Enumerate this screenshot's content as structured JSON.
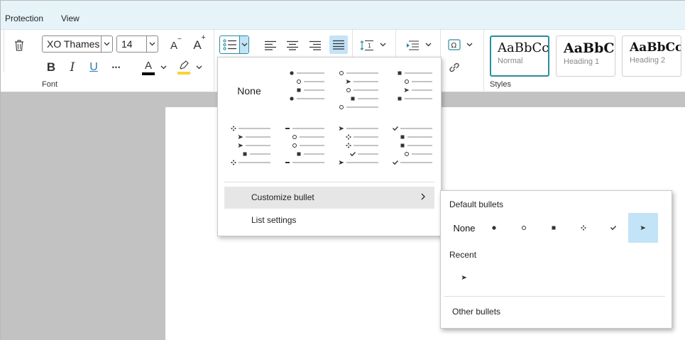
{
  "menubar": {
    "items": [
      "Protection",
      "View"
    ]
  },
  "font": {
    "name": "XO Thames",
    "size": "14",
    "group_label": "Font",
    "bold_icon": "B",
    "italic_icon": "I",
    "underline_icon": "U",
    "more_icon": "•••",
    "font_color_icon": "A",
    "font_color": "#000000",
    "highlight_color": "#f7d33c",
    "grow_icon": "A",
    "shrink_icon": "A"
  },
  "styles": {
    "group_label": "Styles",
    "items": [
      {
        "preview": "AaBbCc",
        "name": "Normal"
      },
      {
        "preview": "AaBbC",
        "name": "Heading 1"
      },
      {
        "preview": "AaBbCc",
        "name": "Heading 2"
      }
    ]
  },
  "bullets_dropdown": {
    "none_label": "None",
    "library": [
      [
        "filled-circle",
        "open-circle",
        "square",
        "filled-circle"
      ],
      [
        "open-circle",
        "arrow",
        "open-circle",
        "square",
        "open-circle"
      ],
      [
        "square",
        "open-circle",
        "arrow",
        "square"
      ],
      [
        "diamond4",
        "arrow",
        "arrow",
        "square",
        "diamond4"
      ],
      [
        "dash",
        "open-circle",
        "open-circle",
        "square",
        "dash"
      ],
      [
        "arrow",
        "diamond4",
        "diamond4",
        "check",
        "arrow"
      ],
      [
        "check",
        "square",
        "square",
        "open-circle",
        "check"
      ]
    ],
    "customize_label": "Customize bullet",
    "list_settings_label": "List settings"
  },
  "submenu": {
    "default_heading": "Default bullets",
    "default_items": [
      {
        "label": "None",
        "icon": "none"
      },
      {
        "label": "●",
        "icon": "filled-circle"
      },
      {
        "label": "○",
        "icon": "open-circle"
      },
      {
        "label": "■",
        "icon": "square"
      },
      {
        "label": "❖",
        "icon": "diamond4"
      },
      {
        "label": "✓",
        "icon": "check"
      },
      {
        "label": "➤",
        "icon": "arrow",
        "selected": true
      }
    ],
    "recent_heading": "Recent",
    "recent_items": [
      {
        "label": "➤",
        "icon": "arrow"
      }
    ],
    "other_label": "Other bullets"
  },
  "colors": {
    "accent": "#2a8ca0",
    "menubar_bg": "#e6f4fa",
    "selection": "#c3e3f7",
    "hover": "#e6e6e6"
  }
}
